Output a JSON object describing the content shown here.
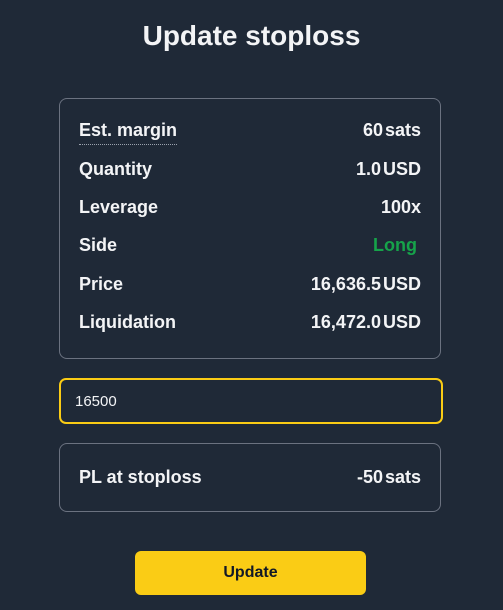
{
  "title": "Update stoploss",
  "details": {
    "est_margin": {
      "label": "Est. margin",
      "value": "60",
      "unit": "sats"
    },
    "quantity": {
      "label": "Quantity",
      "value": "1.0",
      "unit": "USD"
    },
    "leverage": {
      "label": "Leverage",
      "value": "100x"
    },
    "side": {
      "label": "Side",
      "value": "Long",
      "color": "#16a34a"
    },
    "price": {
      "label": "Price",
      "value": "16,636.5",
      "unit": "USD"
    },
    "liquidation": {
      "label": "Liquidation",
      "value": "16,472.0",
      "unit": "USD"
    }
  },
  "stoploss_input": {
    "value": "16500"
  },
  "pl": {
    "label": "PL at stoploss",
    "value": "-50",
    "unit": "sats"
  },
  "update_button": {
    "label": "Update",
    "color": "#facc15"
  },
  "accent_color": "#facc15"
}
